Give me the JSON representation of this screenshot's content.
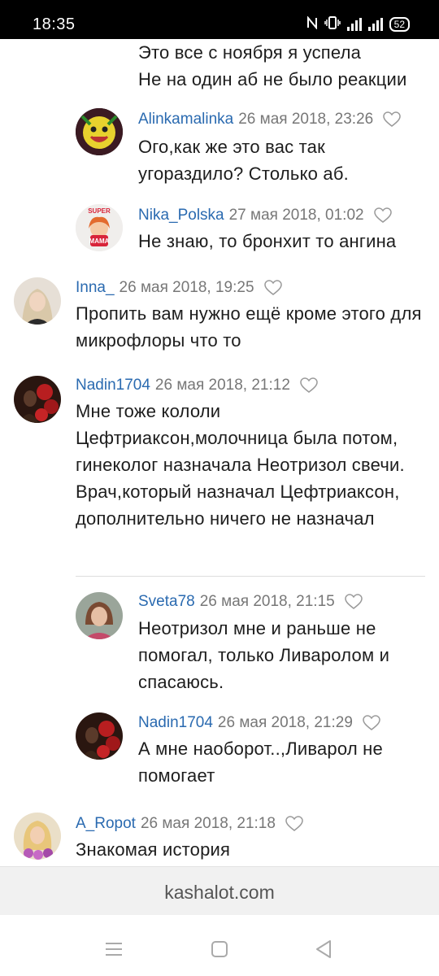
{
  "status_bar": {
    "time": "18:35",
    "battery": "52",
    "icons": [
      "nfc-icon",
      "vibrate-icon",
      "hplus-signal-icon",
      "signal-icon"
    ]
  },
  "comments": [
    {
      "lines": [
        "Это все с ноября я успела",
        "Не на один аб не было реакции"
      ]
    },
    {
      "user": "Alinkamalinka",
      "date": "26 мая 2018, 23:26",
      "avatar": "avatar-alinkamalinka",
      "text": "Ого,как же это вас так угораздило? Столько аб."
    },
    {
      "user": "Nika_Polska",
      "date": "27 мая 2018, 01:02",
      "avatar": "avatar-nika-polska",
      "avatar_badge_top": "SUPER",
      "avatar_badge_bottom": "MAMA",
      "text": "Не знаю, то бронхит то ангина"
    },
    {
      "user": "Inna_",
      "date": "26 мая 2018, 19:25",
      "avatar": "avatar-inna",
      "text": "Пропить вам нужно ещё кроме этого для микрофлоры что то"
    },
    {
      "user": "Nadin1704",
      "date": "26 мая 2018, 21:12",
      "avatar": "avatar-nadin1704",
      "text": "Мне тоже кололи Цефтриаксон,молочница была потом, гинеколог назначала Неотризол свечи.",
      "text2": "Врач,который назначал Цефтриаксон, дополнительно ничего не назначал"
    },
    {
      "user": "Sveta78",
      "date": "26 мая 2018, 21:15",
      "avatar": "avatar-sveta78",
      "text": "Неотризол мне и раньше не помогал, только Ливаролом и спасаюсь."
    },
    {
      "user": "Nadin1704",
      "date": "26 мая 2018, 21:29",
      "avatar": "avatar-nadin1704",
      "text": "А мне наоборот..,Ливарол не помогает"
    },
    {
      "user": "A_Ropot",
      "date": "26 мая 2018, 21:18",
      "avatar": "avatar-a-ropot",
      "text": "Знакомая история"
    }
  ],
  "site_bar": {
    "url": "kashalot.com"
  },
  "nav_bar": {
    "buttons": [
      "menu-icon",
      "home-icon",
      "back-icon"
    ]
  },
  "colors": {
    "username": "#2a6ab0",
    "date": "#777777",
    "text": "#1d1d1d",
    "site_bar_bg": "#f1f1f1"
  }
}
